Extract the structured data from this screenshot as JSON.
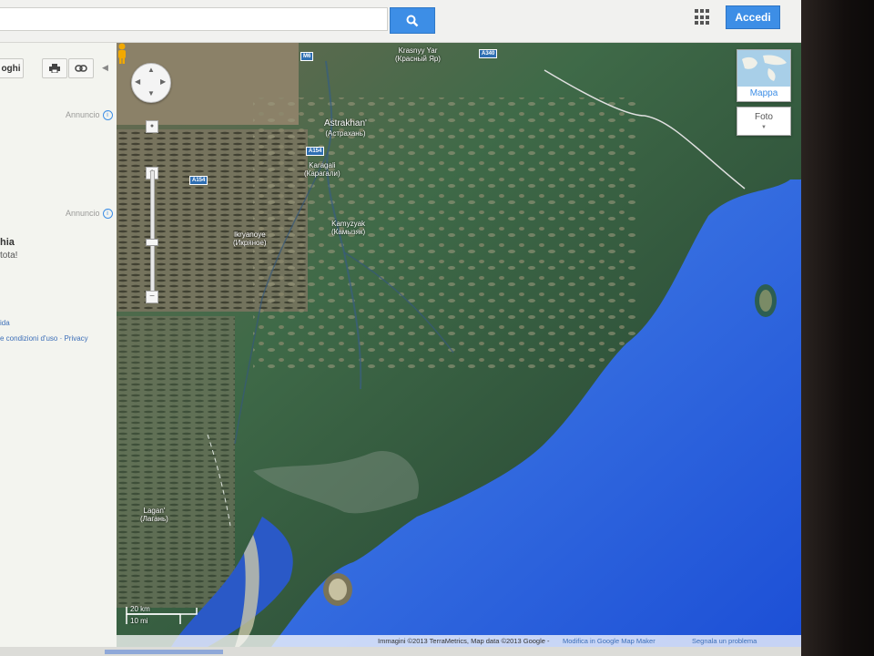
{
  "header": {
    "search_value": "",
    "accedi_label": "Accedi",
    "colors": {
      "accent": "#3d8ee6"
    }
  },
  "left_panel": {
    "share_btn_label": "oghi",
    "annuncio_1": "Annuncio",
    "annuncio_2": "Annuncio",
    "ad_title": "hia",
    "ad_subtitle": "tota!",
    "link_guida": "ida",
    "link_terms": "e condizioni d'uso · Privacy"
  },
  "map": {
    "labels": {
      "krasnyy_yar": "Krasnyy Yar",
      "krasnyy_yar_cyr": "(Красный Яр)",
      "astrakhan": "Astrakhan'",
      "astrakhan_cyr": "(Астрахань)",
      "karagali": "Karagali",
      "karagali_cyr": "(Карагали)",
      "kamyzyak": "Kamyzyak",
      "kamyzyak_cyr": "(Камызяк)",
      "ikryanoye": "Ikryanoye",
      "ikryanoye_cyr": "(Икряное)",
      "lagan": "Lagan'",
      "lagan_cyr": "(Лагань)"
    },
    "shields": {
      "m6": "M6",
      "a340": "A340",
      "a154a": "A154",
      "a154b": "A154"
    },
    "layers": {
      "mappa": "Mappa",
      "foto": "Foto"
    },
    "scale": {
      "km": "20 km",
      "mi": "10 mi"
    },
    "attribution": "Immagini ©2013 TerraMetrics, Map data ©2013 Google -",
    "edit_link": "Modifica in Google Map Maker",
    "report_link": "Segnala un problema"
  }
}
